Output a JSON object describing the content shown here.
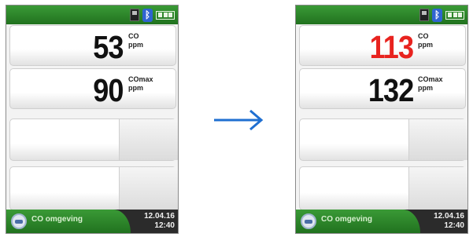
{
  "left": {
    "co_value": "53",
    "co_label": "CO",
    "co_unit": "ppm",
    "comax_value": "90",
    "comax_label": "COmax",
    "comax_unit": "ppm",
    "env_label": "CO omgeving",
    "date": "12.04.16",
    "time": "12:40"
  },
  "right": {
    "co_value": "113",
    "co_label": "CO",
    "co_unit": "ppm",
    "comax_value": "132",
    "comax_label": "COmax",
    "comax_unit": "ppm",
    "env_label": "CO omgeving",
    "date": "12.04.16",
    "time": "12:40"
  },
  "icons": {
    "device": "device-icon",
    "bluetooth": "bluetooth-icon",
    "battery": "battery-icon",
    "menu": "menu-icon",
    "arrow": "arrow-right-icon"
  },
  "colors": {
    "header_green": "#2c8a2a",
    "alarm_red": "#e8231f",
    "value_black": "#111111",
    "arrow_blue": "#1f6fd1"
  }
}
